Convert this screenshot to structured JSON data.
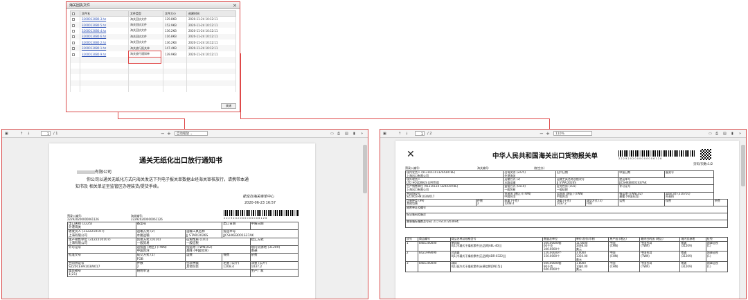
{
  "dialog": {
    "title": "海关回执文件",
    "close_glyph": "×",
    "headers": [
      "文件名",
      "文件类型",
      "文件大小",
      "创建时间"
    ],
    "rows": [
      {
        "name": "3200013080.3.hz",
        "type": "海关回执文件",
        "size": "129.8KB",
        "time": "2020-11-24 10:12:11"
      },
      {
        "name": "3200013080.5.hz",
        "type": "海关回执文件",
        "size": "152.9KB",
        "time": "2020-11-24 10:12:11"
      },
      {
        "name": "3200013080.4.hz",
        "type": "海关回执文件",
        "size": "136.2KB",
        "time": "2020-11-24 10:12:11"
      },
      {
        "name": "3200013080.6.hz",
        "type": "海关回执文件",
        "size": "116.8KB",
        "time": "2020-11-24 10:12:11"
      },
      {
        "name": "3200013080.2.hz",
        "type": "海关回执文件",
        "size": "136.2KB",
        "time": "2020-11-24 10:12:11"
      },
      {
        "name": "3200013080.1.hz",
        "type": "海关放行报关单",
        "size": "147.4KB",
        "time": "2020-11-24 10:12:11"
      },
      {
        "name": "3200013080.9.hz",
        "type": "海关放行通知单",
        "size": "139.9KB",
        "time": "2020-11-24 10:12:11"
      }
    ],
    "confirm_label": "关闭"
  },
  "left_viewer": {
    "page_current": "1",
    "page_total": "/ 1",
    "zoom": "自动缩放",
    "doc_title": "通关无纸化出口放行通知书",
    "addressee": "有限公司",
    "body_line1": "你公司以通关无纸化方式向海关发送下列电子报关单数据业经海关审核放行，请携带本通",
    "body_line2": "知书及 相关单证至监管区办理装货/提货手续。",
    "sign_office": "航空办海关审单中心",
    "sign_date": "2020-06-23  16:57",
    "barcode_text": "2 2 2 9 2 0 2 0 0 0 0 0 0 0 0 6 1 2 6",
    "pre_entry_label": "预录入编号:",
    "pre_entry_value": "222920200000061126",
    "customs_no_label": "海关编号:",
    "customs_no_value": "222920200000061126",
    "cells": {
      "export_port_label": "出口关别 (2225)",
      "export_port_value": "外港海关",
      "record_no_label": "备案号",
      "export_date_label": "出口日期",
      "declare_date_label": "申报日期",
      "consignee_label": "收发货人 (3122210107)",
      "consignee_value": "上海有限公司",
      "transport_label": "运输方式 (2)",
      "transport_value": "水路运输",
      "vehicle_label": "运输工具名称",
      "vehicle_value": "JJ STAR/2026S",
      "bill_label": "提运单号",
      "bill_value": "JJCSHKEB001S37AK",
      "producer_label": "生产销售单位 (3122210107)",
      "producer_value": "上海有限公司",
      "trade_label": "贸易方式 (0110)",
      "trade_value": "一般贸易",
      "tax_label": "征免性质 (101)",
      "tax_value": "一般征税",
      "settle_label": "结汇方式",
      "license_label": "许可证号",
      "country_label": "运抵国 (地区) (TWN)",
      "country_value": "中国台湾",
      "port_label": "指运港 (TWN102)",
      "port_value": "基隆 (中国台湾)",
      "domestic_label": "境内货源地 (31209)",
      "domestic_value": "南通",
      "approval_label": "批准文号",
      "deal_label": "成交方式 (1)",
      "deal_value": "FOB",
      "freight_label": "运费",
      "premium_label": "保费",
      "misc_label": "杂费",
      "contract_label": "合同协议号",
      "contract_value": "SZ20CEH9103W017",
      "pieces_label": "件数",
      "pieces_value": "2",
      "package_label": "包装种类",
      "package_value": "其他包装",
      "gross_label": "毛重 (公斤)",
      "gross_value": "1208.4",
      "net_label": "净重 (公斤)",
      "net_value": "1037.2",
      "container_label": "集装箱号",
      "container_value": "1(21)",
      "docs_label": "随附单证",
      "maker_label": "生产厂家"
    }
  },
  "right_viewer": {
    "page_current": "1",
    "page_total": "/ 2",
    "zoom": "110%",
    "doc_title": "中华人民共和国海关出口货物报关单",
    "page_info": "页码/页数:1/2",
    "barcode_text": "2 2 2 9 2 0 2 0 0 0 0 0 0 0 0 6 1 2 6",
    "pre_entry_label": "预录入编号:",
    "customs_no_label": "海关编号:",
    "customs_office": "(航空办)",
    "header_cells": {
      "shipper_label": "境内发货人 (91310110732443978E)",
      "shipper_value": "上海出口有限公司",
      "port_label": "出境关别 (2225)",
      "port_value": "外港海关",
      "export_date_label": "出口日期",
      "declare_date_label": "申报日期",
      "record_label": "备案号",
      "consignee_label": "境外收货人",
      "consignee_value": "LTD HOLDINGS LIMITED",
      "transport_label": "运输方式 (2)",
      "transport_value": "水路运输",
      "vehicle_label": "运输工具名称及航次号",
      "vehicle_value": "JJ STAR/2026S",
      "bill_label": "提运单号",
      "bill_value": "JJCSHKEB001S37AK",
      "producer_label": "生产销售单位 (91310110732443978E)",
      "producer_value": "上海出口有限公司",
      "supervise_label": "监管方式 (0110)",
      "supervise_value": "一般贸易",
      "tax_label": "征免性质 (101)",
      "tax_value": "一般征税",
      "license_label": "许可证号",
      "contract_label": "合同协议号",
      "contract_value": "SZ20CEH9103W017",
      "trade_country_label": "贸易国 (地区) (TWN)",
      "trade_country_value": "中国台湾",
      "dest_country_label": "运抵国 (地区) (TWN)",
      "dest_country_value": "中国台湾",
      "dest_port_label": "指运港 (TWN102)",
      "dest_port_value": "基隆 (中国台湾)",
      "exit_port_label": "离境口岸 (310701)",
      "exit_port_value": "外高桥",
      "pkg_label": "包装种类 (99)",
      "pkg_value": "其他包装",
      "pieces_label": "件数",
      "pieces_value": "2",
      "gross_label": "毛重 (千克)",
      "gross_value": "1208.4",
      "net_label": "净重 (千克)",
      "net_value": "1037.2",
      "deal_label": "成交方式 (3)",
      "deal_value": "FOB",
      "freight_label": "运费",
      "premium_label": "保费",
      "misc_label": "杂费",
      "docs_label": "随附单证及编号",
      "marks_label": "标记唛码及备注",
      "extra_label": "集装箱标箱数及号码: 21; FSCU7203694;"
    },
    "items_headers": [
      "项号",
      "商品编号",
      "商品名称及规格型号",
      "数量及单位",
      "单价/总价/币制",
      "原产国 (地区)",
      "最终目的国 (地区)",
      "境内货源地",
      "征免"
    ],
    "items": [
      {
        "no": "1",
        "code": "8481300000",
        "name": "单向阀",
        "spec": "0|1|冷凝式干燥机零件|无品牌|AEL-40|||",
        "qty": "300.00000套",
        "qty2": "60千克",
        "qty3": "300.0000个",
        "price": "11.6600",
        "total": "3498.00",
        "currency": "美元",
        "origin": "中国",
        "origin_code": "(CHN)",
        "dest": "中国台湾",
        "dest_code": "(TWN)",
        "source": "南通",
        "source_code": "(31209)",
        "tax": "照章征税",
        "tax_code": "(1)"
      },
      {
        "no": "2",
        "code": "8421999090",
        "name": "过滤器",
        "spec": "0|1|冷凝式干燥机零件|无品牌|ADR-0322|||",
        "qty": "150.00000个",
        "qty2": "",
        "qty3": "150.0000个",
        "price": "3.0000",
        "total": "1350.00",
        "currency": "美元",
        "origin": "中国",
        "origin_code": "(CHN)",
        "dest": "中国台湾",
        "dest_code": "(TWN)",
        "source": "南通",
        "source_code": "(31209)",
        "tax": "照章征税",
        "tax_code": "(1)"
      },
      {
        "no": "3",
        "code": "8481300000",
        "name": "球阀",
        "spec": "0|1|低冷式干燥机零件|永德信牌|DN15|||",
        "qty": "600.00000套",
        "qty2": "90千克",
        "qty3": "600.0000个",
        "price": "1.8000",
        "total": "1080.00",
        "currency": "美元",
        "origin": "中国",
        "origin_code": "(CHN)",
        "dest": "中国台湾",
        "dest_code": "(TWN)",
        "source": "南通",
        "source_code": "(31209)",
        "tax": "照章征税",
        "tax_code": "(1)"
      }
    ]
  },
  "colors": {
    "accent_red": "#e04848",
    "link_blue": "#2a4fb5"
  },
  "icons": [
    "sidebar-toggle-icon",
    "arrow-up-icon",
    "arrow-down-icon",
    "zoom-out-icon",
    "zoom-in-icon",
    "present-icon",
    "print-icon",
    "save-icon",
    "bookmark-icon",
    "more-tools-icon",
    "customs-emblem-icon",
    "qr-code-icon"
  ]
}
